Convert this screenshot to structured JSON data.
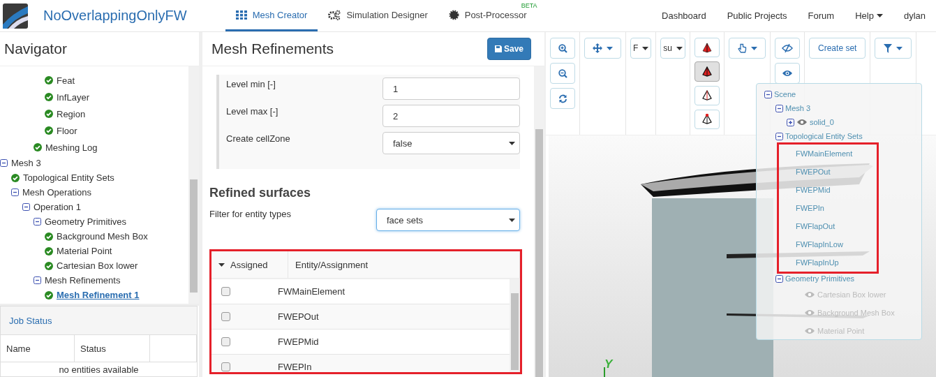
{
  "app": {
    "title": "NoOverlappingOnlyFW"
  },
  "nav_tabs": [
    {
      "label": "Mesh Creator",
      "selected": true
    },
    {
      "label": "Simulation Designer",
      "selected": false
    },
    {
      "label": "Post-Processor",
      "selected": false,
      "badge": "BETA"
    }
  ],
  "nav_links": [
    {
      "label": "Dashboard",
      "dropdown": false
    },
    {
      "label": "Public Projects",
      "dropdown": false
    },
    {
      "label": "Forum",
      "dropdown": false
    },
    {
      "label": "Help",
      "dropdown": true
    },
    {
      "label": "dylan",
      "dropdown": false
    }
  ],
  "navigator": {
    "title": "Navigator",
    "tree": [
      {
        "children": [
          {
            "children": [
              {
                "children": [
                  {
                    "children": [
                      {
                        "label": "Feat",
                        "selected": false
                      },
                      {
                        "label": "InfLayer",
                        "selected": false
                      },
                      {
                        "label": "Region",
                        "selected": false
                      },
                      {
                        "label": "Floor",
                        "selected": false
                      }
                    ]
                  },
                  {
                    "label": "Meshing Log",
                    "selected": false
                  }
                ]
              }
            ]
          }
        ]
      },
      {
        "label": "Mesh 3",
        "expanded": true,
        "selected": false,
        "children": [
          {
            "label": "Topological Entity Sets",
            "selected": false
          },
          {
            "label": "Mesh Operations",
            "expanded": true,
            "selected": false,
            "children": [
              {
                "label": "Operation 1",
                "expanded": true,
                "selected": false,
                "children": [
                  {
                    "label": "Geometry Primitives",
                    "expanded": true,
                    "selected": false,
                    "children": [
                      {
                        "label": "Background Mesh Box",
                        "selected": false
                      },
                      {
                        "label": "Material Point",
                        "selected": false
                      },
                      {
                        "label": "Cartesian Box lower",
                        "selected": false
                      }
                    ]
                  },
                  {
                    "label": "Mesh Refinements",
                    "expanded": true,
                    "selected": false,
                    "children": [
                      {
                        "label": "Mesh Refinement 1",
                        "selected": true
                      }
                    ]
                  }
                ]
              }
            ]
          }
        ]
      }
    ]
  },
  "job_status": {
    "title": "Job Status",
    "columns": [
      "Name",
      "Status"
    ],
    "empty_text": "no entities available"
  },
  "editor": {
    "title": "Mesh Refinements",
    "save_label": "Save",
    "fields": [
      {
        "label": "Level min [-]",
        "kind": "input",
        "value": "1"
      },
      {
        "label": "Level max [-]",
        "kind": "input",
        "value": "2"
      },
      {
        "label": "Create cellZone",
        "kind": "select",
        "value": "false"
      }
    ],
    "section_title": "Refined surfaces",
    "filter": {
      "label": "Filter for entity types",
      "value": "face sets",
      "focused": true
    },
    "table": {
      "highlighted": true,
      "columns": [
        "Assigned",
        "Entity/Assignment"
      ],
      "rows": [
        {
          "name": "FWMainElement",
          "checked": false
        },
        {
          "name": "FWEPOut",
          "checked": false
        },
        {
          "name": "FWEPMid",
          "checked": false
        },
        {
          "name": "FWEPIn",
          "checked": false
        }
      ]
    }
  },
  "viewer": {
    "toolbar": [
      {
        "buttons": [
          {
            "kind": "icon"
          },
          {
            "kind": "icon"
          },
          {
            "kind": "icon"
          }
        ]
      },
      {
        "buttons": [
          {
            "kind": "dropdown"
          }
        ]
      },
      {
        "buttons": [
          {
            "kind": "select",
            "value": "F"
          }
        ]
      },
      {
        "buttons": [
          {
            "kind": "select",
            "value": "su"
          }
        ]
      },
      {
        "buttons": [
          {
            "kind": "icon",
            "selected": false
          },
          {
            "kind": "icon",
            "selected": true
          },
          {
            "kind": "icon",
            "selected": false
          },
          {
            "kind": "icon",
            "selected": false
          }
        ]
      },
      {
        "buttons": [
          {
            "kind": "dropdown"
          }
        ]
      },
      {
        "buttons": [
          {
            "kind": "icon"
          },
          {
            "kind": "icon"
          }
        ]
      },
      {
        "buttons": [
          {
            "kind": "text",
            "label": "Create set"
          }
        ]
      },
      {
        "buttons": [
          {
            "kind": "dropdown"
          }
        ]
      }
    ],
    "scene": [
      {
        "label": "Scene",
        "expanded": true,
        "children": [
          {
            "label": "Mesh 3",
            "expanded": true,
            "children": [
              {
                "label": "solid_0",
                "expanded": false,
                "visible": true
              }
            ]
          },
          {
            "label": "Topological Entity Sets",
            "expanded": true,
            "highlighted": true,
            "children": [
              {
                "label": "FWMainElement"
              },
              {
                "label": "FWEPOut"
              },
              {
                "label": "FWEPMid"
              },
              {
                "label": "FWEPIn"
              },
              {
                "label": "FWFlapOut"
              },
              {
                "label": "FWFlapInLow"
              },
              {
                "label": "FWFlapInUp"
              }
            ]
          },
          {
            "label": "Geometry Primitives",
            "expanded": true,
            "highlighted": false,
            "children": [
              {
                "label": "Cartesian Box lower",
                "visible": false
              },
              {
                "label": "Background Mesh Box",
                "visible": false
              },
              {
                "label": "Material Point",
                "visible": false
              }
            ]
          }
        ]
      }
    ],
    "axis_label": "Y"
  }
}
